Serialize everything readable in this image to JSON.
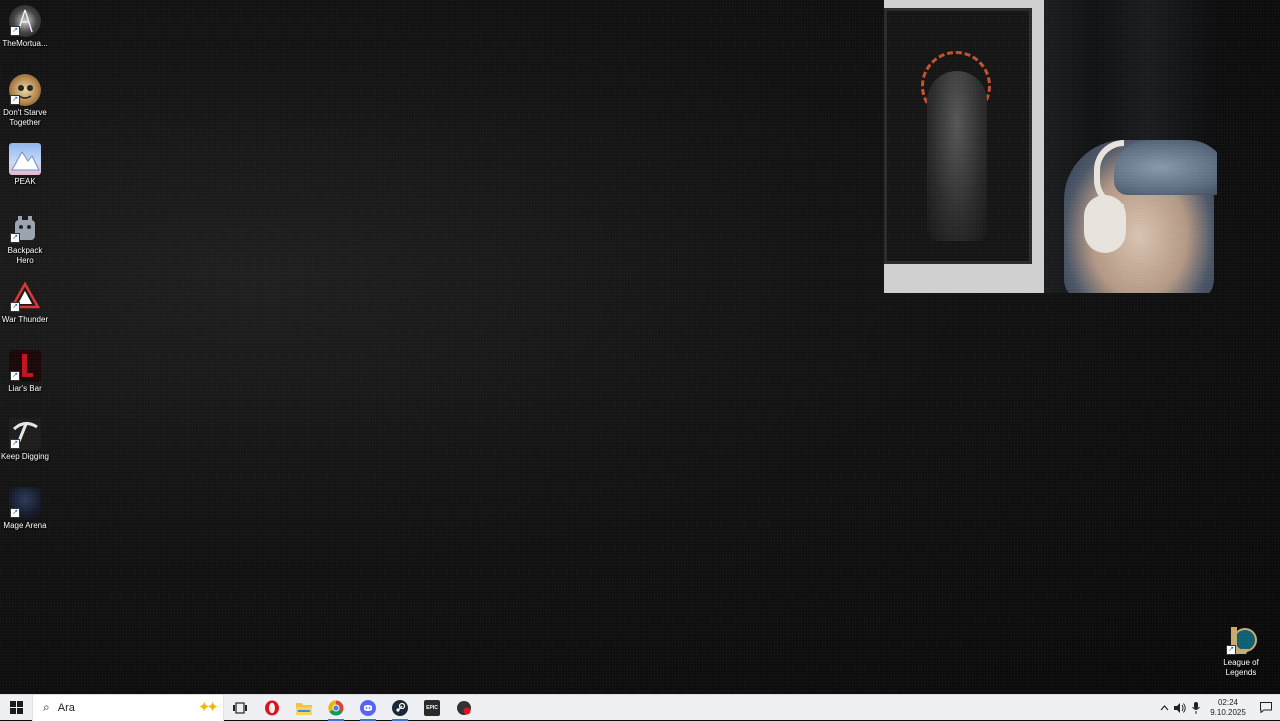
{
  "desktop": {
    "icons": [
      {
        "label": "TheMortua...",
        "icon": "mortuary-assistant-icon"
      },
      {
        "label": "Don't Starve Together",
        "icon": "dont-starve-together-icon"
      },
      {
        "label": "PEAK",
        "icon": "peak-icon"
      },
      {
        "label": "Backpack Hero",
        "icon": "backpack-hero-icon"
      },
      {
        "label": "War Thunder",
        "icon": "war-thunder-icon"
      },
      {
        "label": "Liar's Bar",
        "icon": "liars-bar-icon"
      },
      {
        "label": "Keep Digging",
        "icon": "keep-digging-icon"
      },
      {
        "label": "Mage Arena",
        "icon": "mage-arena-icon"
      }
    ],
    "right_icon": {
      "label": "League of Legends",
      "icon": "league-of-legends-icon"
    }
  },
  "taskbar": {
    "search_placeholder": "Ara",
    "pinned": [
      {
        "name": "task-view",
        "icon": "task-view-icon"
      },
      {
        "name": "opera",
        "icon": "opera-icon",
        "color": "#e0121b"
      },
      {
        "name": "file-explorer",
        "icon": "folder-icon",
        "color": "#f5c243"
      },
      {
        "name": "chrome",
        "icon": "chrome-icon",
        "active": true
      },
      {
        "name": "discord",
        "icon": "discord-icon",
        "color": "#5865f2",
        "active": true
      },
      {
        "name": "steam",
        "icon": "steam-icon",
        "color": "#1b2838",
        "active": true
      },
      {
        "name": "epic-games",
        "icon": "epic-games-icon",
        "glyph": "EPIC",
        "color": "#2a2a2a"
      },
      {
        "name": "obs",
        "icon": "record-icon",
        "color": "#333333"
      }
    ],
    "tray": {
      "time": "02:24",
      "date": "9.10.2025"
    }
  }
}
